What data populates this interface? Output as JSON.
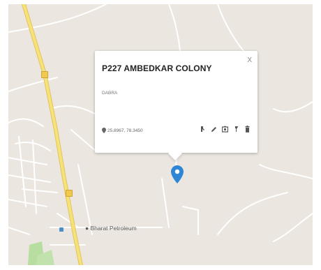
{
  "popup": {
    "title": "P227 AMBEDKAR COLONY",
    "subtitle": "DABRA",
    "coordinates": "25.8967, 78.3450",
    "close_label": "X",
    "tools": [
      "directions-icon",
      "edit-icon",
      "photo-icon",
      "pin-tool-icon",
      "delete-icon"
    ]
  },
  "map": {
    "place_label": "Bharat Petroleum",
    "colors": {
      "land": "#ebe7e0",
      "road": "#ffffff",
      "highway": "#f6e27a",
      "highway_edge": "#e3c458",
      "marker": "#2f86d6",
      "park": "#b7dda0"
    }
  }
}
